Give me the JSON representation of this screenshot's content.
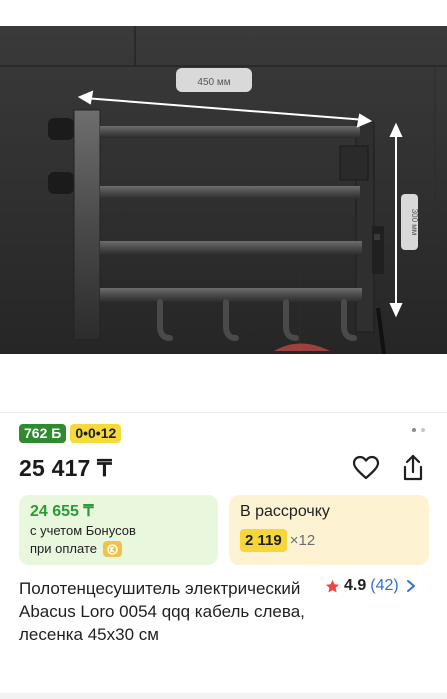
{
  "image": {
    "dimension_label": "450 мм",
    "height_label": "300 мм"
  },
  "badges": {
    "bonus": "762 Б",
    "installment": "0•0•12"
  },
  "price": "25 417 ₸",
  "bonus_box": {
    "price": "24 655 ₸",
    "note_line1": "с учетом Бонусов",
    "note_line2": "при оплате"
  },
  "installment_box": {
    "label": "В рассрочку",
    "amount": "2 119",
    "times": "×12"
  },
  "product": {
    "title": "Полотенцесушитель электрический Abacus Loro 0054 qqq кабель слева, лесенка 45х30 см"
  },
  "rating": {
    "value": "4.9",
    "count": "(42)"
  },
  "colors": {
    "bonus_green": "#2e8b2e",
    "installment_yellow": "#f6d93b",
    "link_blue": "#2f6fd6",
    "star_red": "#e8483f"
  }
}
